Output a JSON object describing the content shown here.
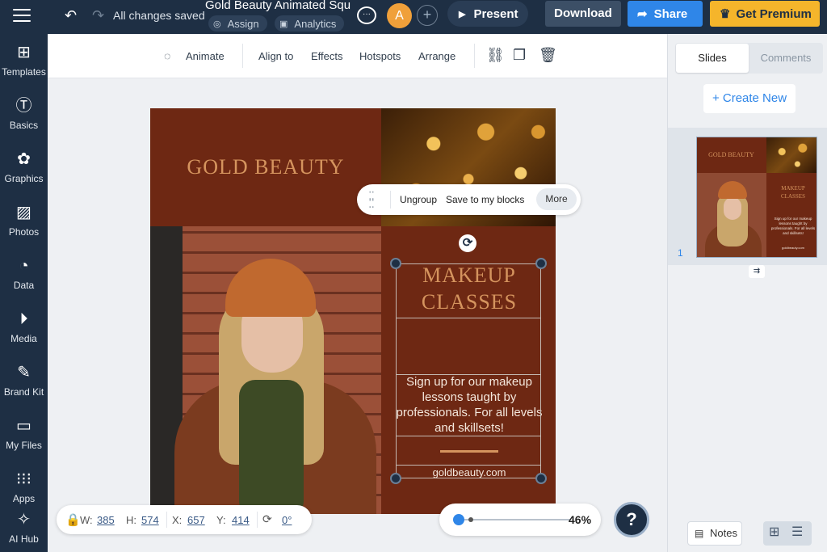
{
  "topbar": {
    "saved_status": "All changes saved",
    "doc_title": "Gold Beauty Animated Squ...",
    "assign_label": "Assign",
    "analytics_label": "Analytics",
    "avatar_initial": "A",
    "present_label": "Present",
    "download_label": "Download",
    "share_label": "Share",
    "premium_label": "Get Premium"
  },
  "sidebar": {
    "items": [
      {
        "label": "Templates",
        "icon": "templates-icon"
      },
      {
        "label": "Basics",
        "icon": "basics-icon"
      },
      {
        "label": "Graphics",
        "icon": "graphics-icon"
      },
      {
        "label": "Photos",
        "icon": "photos-icon"
      },
      {
        "label": "Data",
        "icon": "data-icon"
      },
      {
        "label": "Media",
        "icon": "media-icon"
      },
      {
        "label": "Brand Kit",
        "icon": "brand-kit-icon"
      },
      {
        "label": "My Files",
        "icon": "my-files-icon"
      },
      {
        "label": "Apps",
        "icon": "apps-icon"
      },
      {
        "label": "AI Hub",
        "icon": "ai-hub-icon"
      }
    ]
  },
  "toolbar": {
    "animate_label": "Animate",
    "align_label": "Align to",
    "effects_label": "Effects",
    "hotspots_label": "Hotspots",
    "arrange_label": "Arrange"
  },
  "slide": {
    "title": "GOLD BEAUTY",
    "heading_line1": "MAKEUP",
    "heading_line2": "CLASSES",
    "body": "Sign up for our makeup lessons taught by professionals. For all levels and skillsets!",
    "website": "goldbeauty.com"
  },
  "context_menu": {
    "ungroup_label": "Ungroup",
    "save_label": "Save to my blocks",
    "more_label": "More"
  },
  "dimensions": {
    "w_label": "W:",
    "w_value": "385",
    "h_label": "H:",
    "h_value": "574",
    "x_label": "X:",
    "x_value": "657",
    "y_label": "Y:",
    "y_value": "414",
    "rotation_value": "0°"
  },
  "zoom": {
    "level": "46%",
    "slider_fraction": 0.0
  },
  "help_label": "?",
  "right_panel": {
    "tab_slides": "Slides",
    "tab_comments": "Comments",
    "create_new_label": "+ Create New",
    "thumb_number": "1",
    "notes_label": "Notes"
  },
  "colors": {
    "navy": "#1e2f44",
    "accent_blue": "#2f86e8",
    "premium_yellow": "#f5b52b",
    "slide_maroon": "#6e2813",
    "slide_gold": "#d5945e"
  }
}
